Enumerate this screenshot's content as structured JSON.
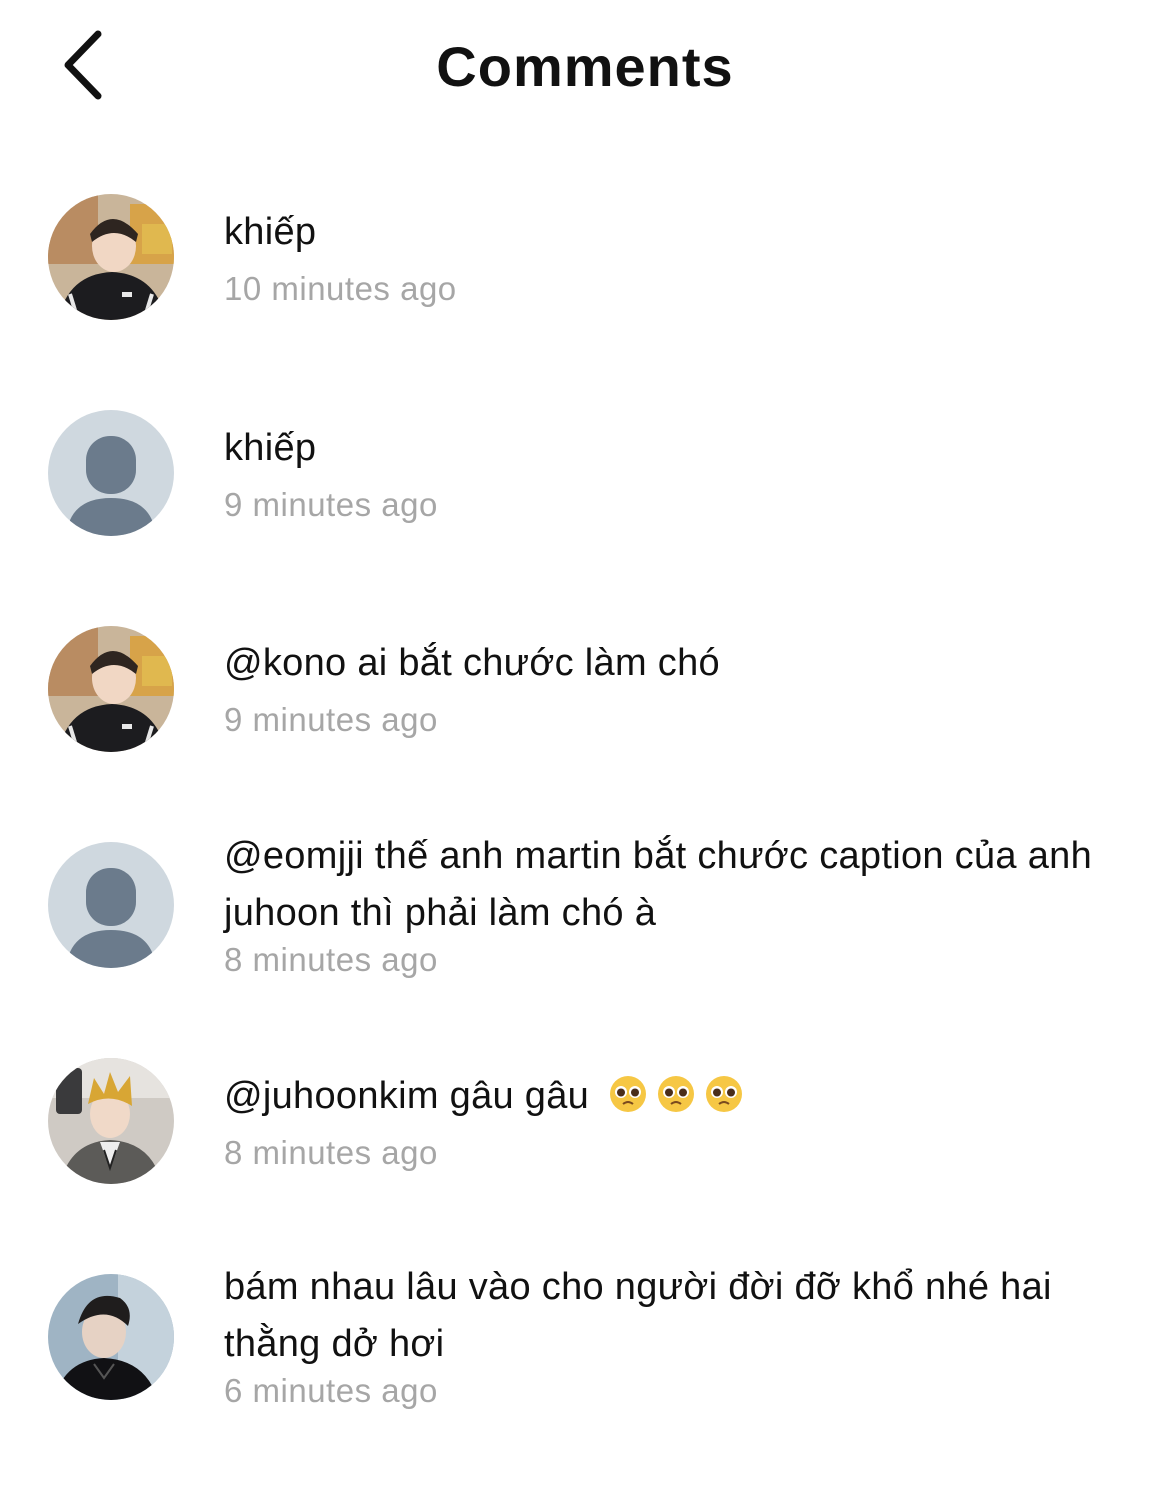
{
  "header": {
    "title": "Comments",
    "back_icon": "chevron-left-icon"
  },
  "comments": [
    {
      "avatar": "photo-avatar-black-jacket",
      "text": "khiếp",
      "time": "10 minutes ago"
    },
    {
      "avatar": "default-avatar-placeholder",
      "text": "khiếp",
      "time": "9 minutes ago"
    },
    {
      "avatar": "photo-avatar-black-jacket",
      "text": "@kono ai bắt chước làm chó",
      "time": "9 minutes ago"
    },
    {
      "avatar": "default-avatar-placeholder",
      "text": "@eomjji thế anh martin bắt chước caption của anh juhoon thì phải làm chó à",
      "time": "8 minutes ago"
    },
    {
      "avatar": "photo-avatar-blond-mirror-selfie",
      "text": "@juhoonkim gâu gâu",
      "emoji": "pleading-face-emoji",
      "emoji_count": 3,
      "time": "8 minutes ago"
    },
    {
      "avatar": "photo-avatar-dark-hair-portrait",
      "text": "bám nhau lâu vào cho người đời đỡ khổ nhé hai thằng dở hơi",
      "time": "6 minutes ago"
    }
  ],
  "colors": {
    "text": "#111111",
    "timestamp": "#a6a6a6",
    "placeholder_bg": "#cfd8df",
    "placeholder_figure": "#6b7b8c"
  }
}
